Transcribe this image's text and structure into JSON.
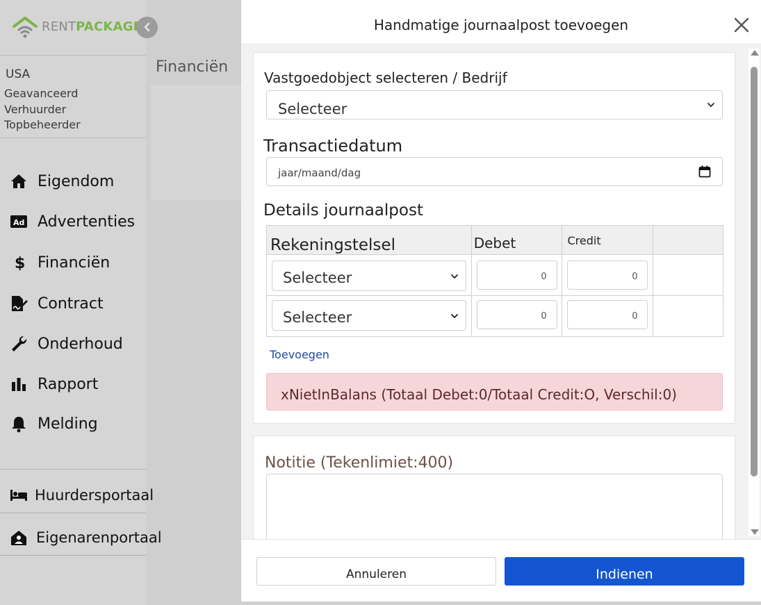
{
  "brand": {
    "rent": "RENT",
    "package": "PACKAGE"
  },
  "user": {
    "country": "USA",
    "lines": [
      "Geavanceerd",
      "Verhuurder",
      "Topbeheerder"
    ]
  },
  "nav": {
    "items": [
      {
        "label": "Eigendom",
        "icon": "home-icon"
      },
      {
        "label": "Advertenties",
        "icon": "ad-icon"
      },
      {
        "label": "Financiën",
        "icon": "dollar-icon"
      },
      {
        "label": "Contract",
        "icon": "contract-icon"
      },
      {
        "label": "Onderhoud",
        "icon": "wrench-icon"
      },
      {
        "label": "Rapport",
        "icon": "bar-chart-icon"
      },
      {
        "label": "Melding",
        "icon": "bell-icon"
      }
    ],
    "portals": [
      {
        "label": "Huurdersportaal",
        "icon": "bed-icon"
      },
      {
        "label": "Eigenarenportaal",
        "icon": "house-user-icon"
      }
    ]
  },
  "background": {
    "page_title": "Financiën"
  },
  "modal": {
    "title": "Handmatige journaalpost toevoegen",
    "property_label": "Vastgoedobject selecteren / Bedrijf",
    "property_select": "Selecteer",
    "date_label": "Transactiedatum",
    "date_placeholder": "jaar/maand/dag",
    "details_label": "Details journaalpost",
    "table": {
      "headers": [
        "Rekeningstelsel",
        "Debet",
        "Credit",
        ""
      ],
      "rows": [
        {
          "account": "Selecteer",
          "debit": "0",
          "credit": "0"
        },
        {
          "account": "Selecteer",
          "debit": "0",
          "credit": "0"
        }
      ]
    },
    "add_link": "Toevoegen",
    "alert": "xNietInBalans (Totaal Debet:0/Totaal Credit:O, Verschil:0)",
    "note_label": "Notitie (Tekenlimiet:400)",
    "cancel": "Annuleren",
    "submit": "Indienen"
  },
  "colors": {
    "accent": "#1456d1",
    "brand_green": "#7ab648",
    "alert_bg": "#f7d6da",
    "link": "#1f4aa6"
  }
}
